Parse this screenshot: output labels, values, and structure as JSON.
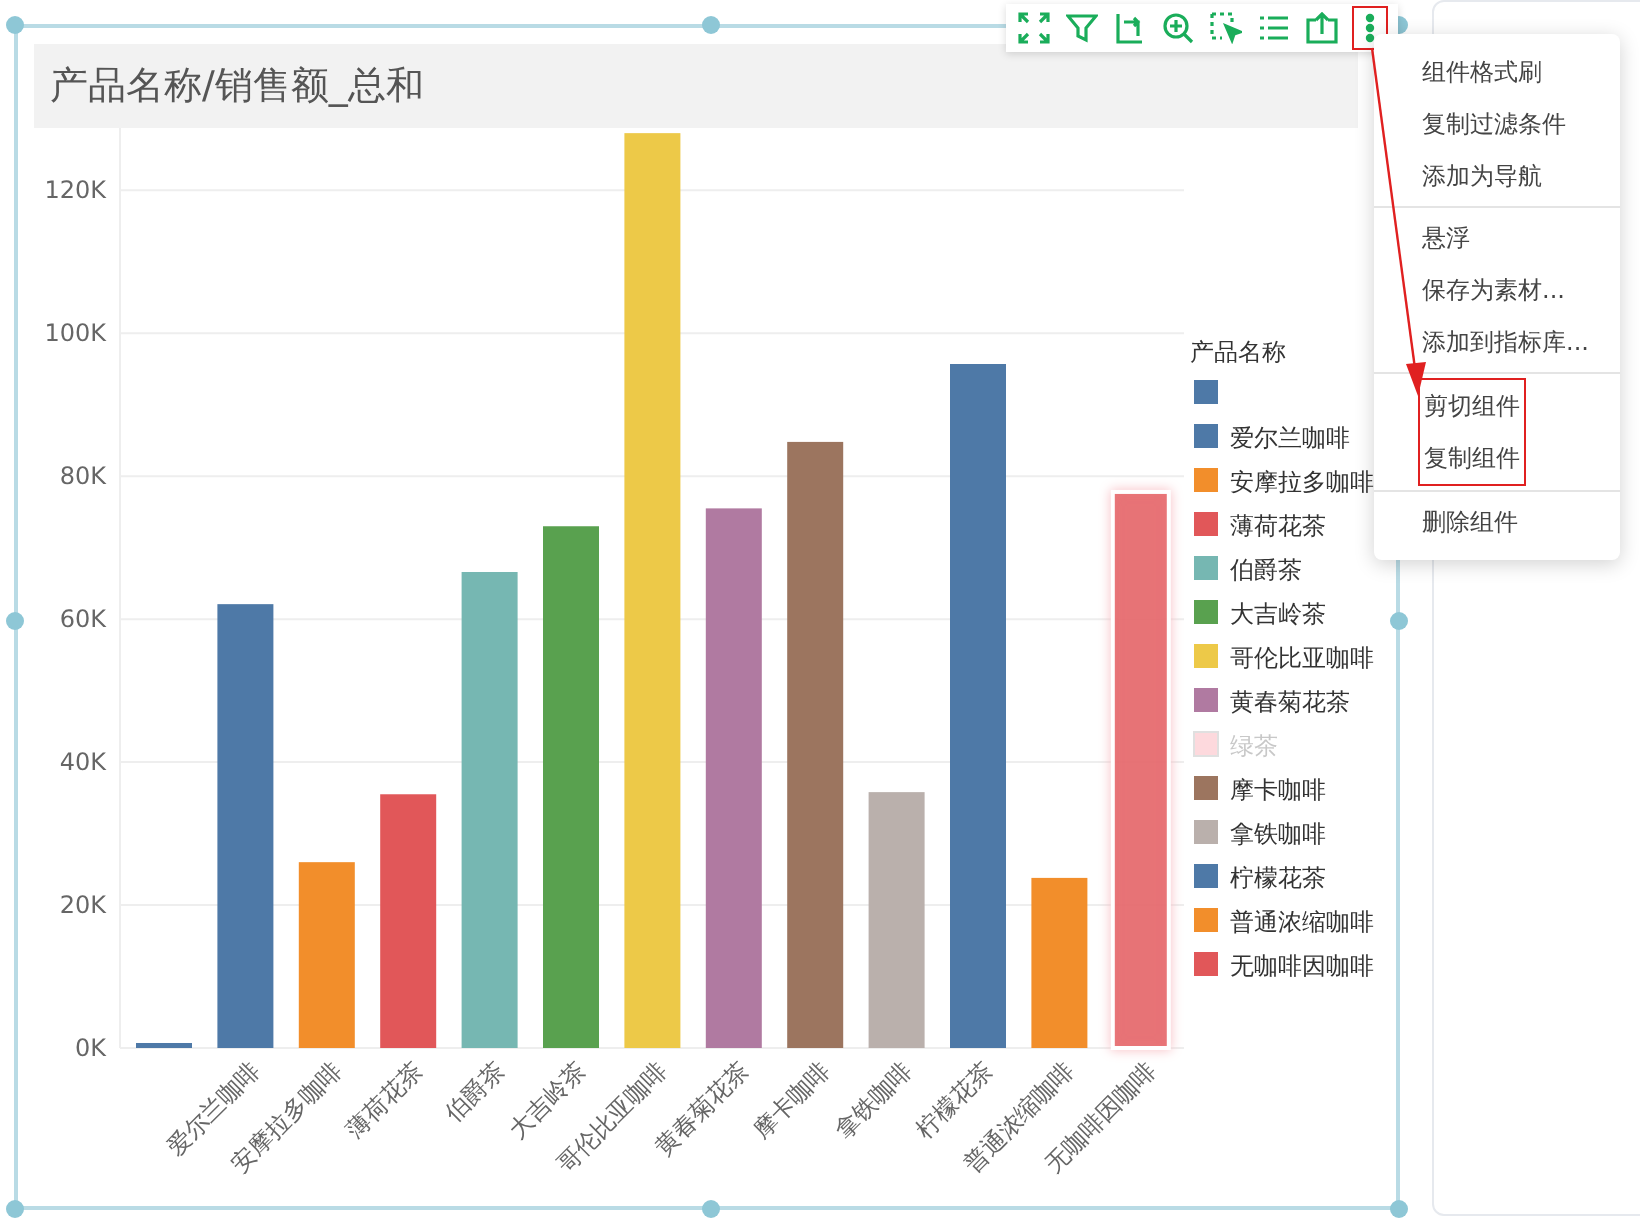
{
  "widget": {
    "title": "产品名称/销售额_总和",
    "chart_data": {
      "type": "bar",
      "categories": [
        null,
        "爱尔兰咖啡",
        "安摩拉多咖啡",
        "薄荷花茶",
        "伯爵茶",
        "大吉岭茶",
        "哥伦比亚咖啡",
        "黄春菊花茶",
        "摩卡咖啡",
        "拿铁咖啡",
        "柠檬花茶",
        "普通浓缩咖啡",
        "无咖啡因咖啡"
      ],
      "values": [
        700,
        62100,
        26000,
        35500,
        66600,
        73000,
        128000,
        75500,
        84800,
        35800,
        95700,
        23800,
        77800
      ],
      "grid": true,
      "ylim": [
        0,
        129000
      ],
      "yticks": [
        {
          "value": 0,
          "label": "0K"
        },
        {
          "value": 20000,
          "label": "20K"
        },
        {
          "value": 40000,
          "label": "40K"
        },
        {
          "value": 60000,
          "label": "60K"
        },
        {
          "value": 80000,
          "label": "80K"
        },
        {
          "value": 100000,
          "label": "100K"
        },
        {
          "value": 120000,
          "label": "120K"
        }
      ]
    },
    "bar_selected": [
      false,
      false,
      false,
      false,
      false,
      false,
      false,
      false,
      false,
      false,
      false,
      false,
      true
    ],
    "legend": {
      "title": "产品名称",
      "items": [
        {
          "color": "#4e79a7",
          "disabled": false
        },
        {
          "name": "爱尔兰咖啡",
          "color": "#4e79a7",
          "disabled": false
        },
        {
          "name": "安摩拉多咖啡",
          "color": "#f28e2b",
          "disabled": false
        },
        {
          "name": "薄荷花茶",
          "color": "#e15759",
          "disabled": false
        },
        {
          "name": "伯爵茶",
          "color": "#76b7b2",
          "disabled": false
        },
        {
          "name": "大吉岭茶",
          "color": "#59a14f",
          "disabled": false
        },
        {
          "name": "哥伦比亚咖啡",
          "color": "#edc948",
          "disabled": false
        },
        {
          "name": "黄春菊花茶",
          "color": "#b07aa1",
          "disabled": false
        },
        {
          "name": "绿茶",
          "color": "#fdd9dd",
          "disabled": true
        },
        {
          "name": "摩卡咖啡",
          "color": "#9c755f",
          "disabled": false
        },
        {
          "name": "拿铁咖啡",
          "color": "#bab0ac",
          "disabled": false
        },
        {
          "name": "柠檬花茶",
          "color": "#4e79a7",
          "disabled": false
        },
        {
          "name": "普通浓缩咖啡",
          "color": "#f28e2b",
          "disabled": false
        },
        {
          "name": "无咖啡因咖啡",
          "color": "#e15759",
          "disabled": false
        }
      ]
    }
  },
  "toolbar": [
    {
      "kind": "fullscreen",
      "outlined": false
    },
    {
      "kind": "filter",
      "outlined": false
    },
    {
      "kind": "rotate",
      "outlined": false
    },
    {
      "kind": "zoom",
      "outlined": false
    },
    {
      "kind": "select",
      "outlined": false
    },
    {
      "kind": "list",
      "outlined": false
    },
    {
      "kind": "export",
      "outlined": false
    },
    {
      "kind": "more",
      "outlined": true
    }
  ],
  "menu": {
    "groups": [
      [
        {
          "label": "组件格式刷",
          "outlined": false
        },
        {
          "label": "复制过滤条件",
          "outlined": false
        },
        {
          "label": "添加为导航",
          "outlined": false
        }
      ],
      [
        {
          "label": "悬浮",
          "outlined": false
        },
        {
          "label": "保存为素材...",
          "outlined": false
        },
        {
          "label": "添加到指标库...",
          "outlined": false
        }
      ],
      [
        {
          "label": "剪切组件",
          "outlined": true
        },
        {
          "label": "复制组件",
          "outlined": true
        }
      ],
      [
        {
          "label": "删除组件",
          "outlined": false
        }
      ]
    ]
  }
}
